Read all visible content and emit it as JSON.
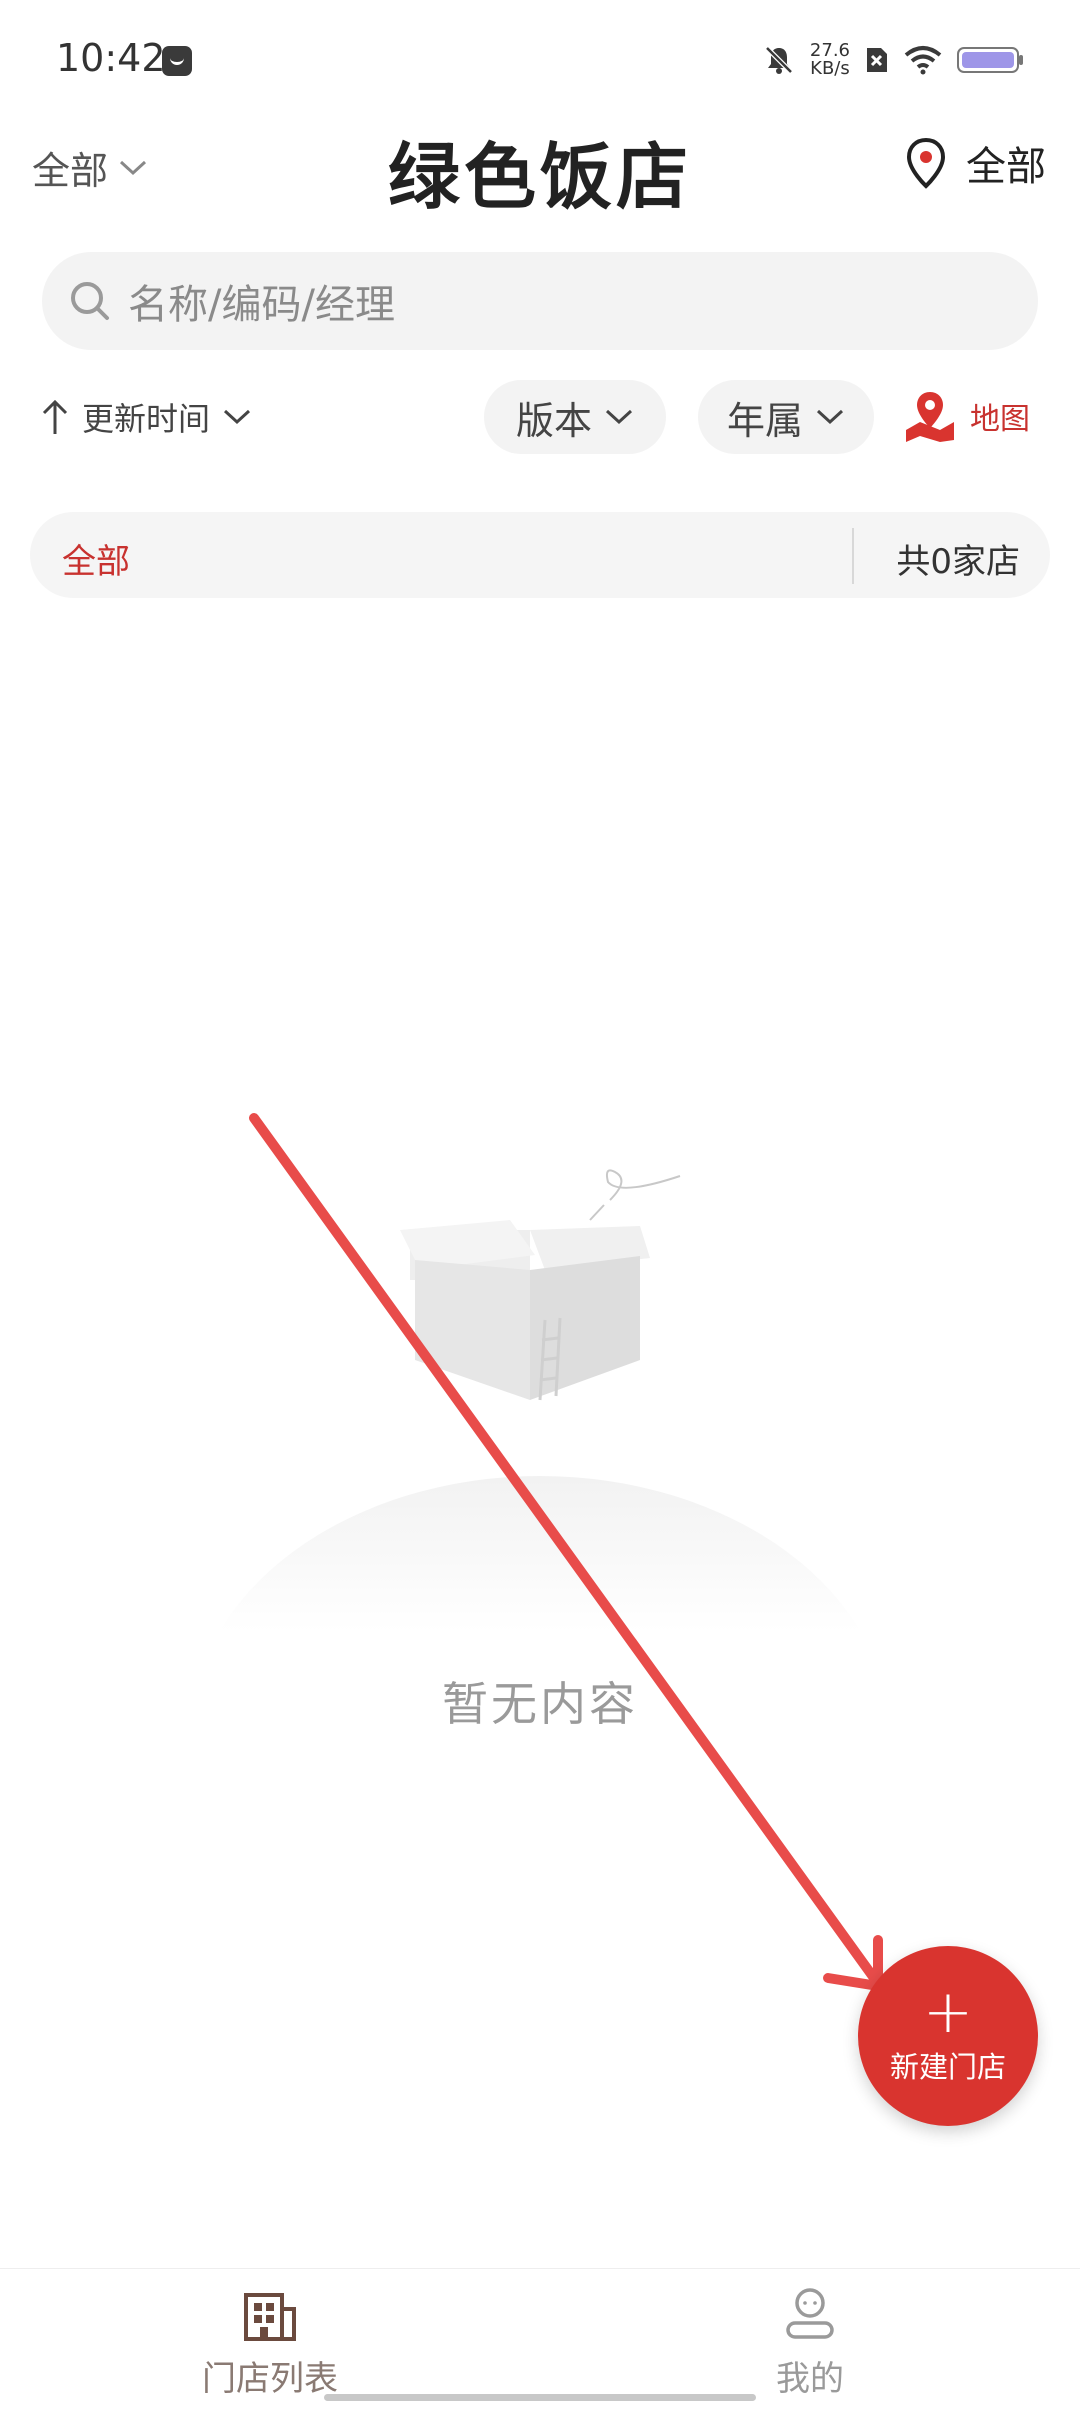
{
  "status_bar": {
    "time": "10:42",
    "net_speed_value": "27.6",
    "net_speed_unit": "KB/s",
    "icons": [
      "message-icon",
      "mute-bell-icon",
      "no-sim-icon",
      "wifi-icon",
      "battery-icon"
    ]
  },
  "header": {
    "scope_label": "全部",
    "title": "绿色饭店",
    "location_label": "全部"
  },
  "search": {
    "placeholder": "名称/编码/经理"
  },
  "filters": {
    "sort_label": "更新时间",
    "version_label": "版本",
    "year_label": "年属",
    "map_label": "地图"
  },
  "category_bar": {
    "active_tab": "全部",
    "count_text": "共0家店"
  },
  "empty_state": {
    "text": "暂无内容"
  },
  "fab": {
    "icon": "+",
    "label": "新建门店"
  },
  "bottom_nav": {
    "items": [
      {
        "label": "门店列表",
        "icon": "store-grid-icon",
        "active": true
      },
      {
        "label": "我的",
        "icon": "profile-icon",
        "active": false
      }
    ]
  },
  "colors": {
    "accent": "#d9342f",
    "accent_text": "#c8322f",
    "annotation": "#e84c4a"
  }
}
